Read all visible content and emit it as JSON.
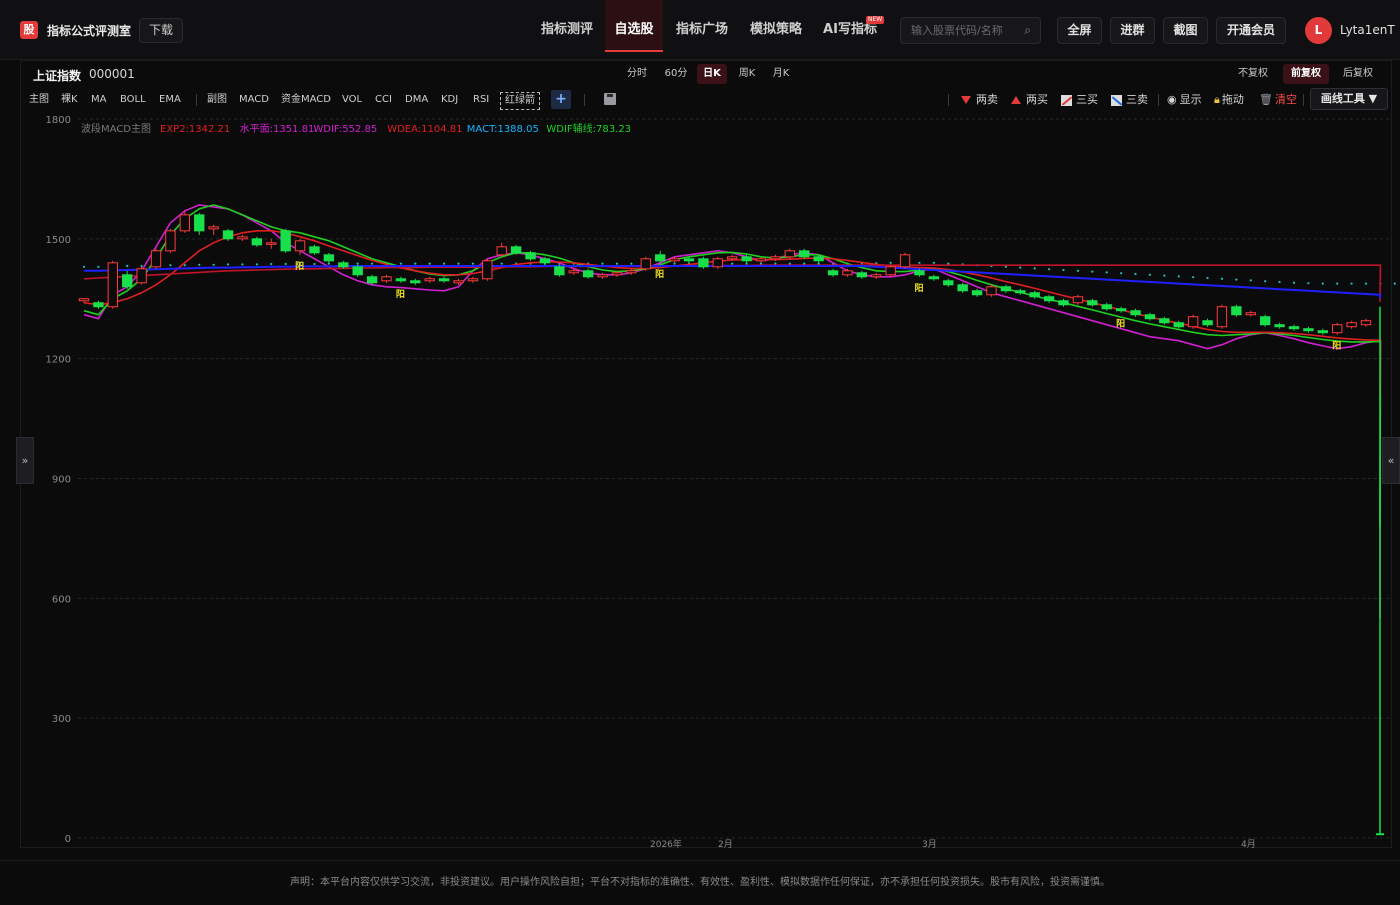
{
  "header": {
    "logo_char": "股",
    "brand": "指标公式评测室",
    "download": "下载",
    "nav": [
      "指标测评",
      "自选股",
      "指标广场",
      "模拟策略",
      "AI写指标"
    ],
    "nav_active": 1,
    "new_badge": "NEW",
    "search_placeholder": "输入股票代码/名称",
    "buttons": [
      "全屏",
      "进群",
      "截图",
      "开通会员"
    ],
    "avatar_letter": "L",
    "username": "Lyta1enT"
  },
  "stock": {
    "name": "上证指数",
    "code": "000001"
  },
  "periods": [
    "分时",
    "60分",
    "日K",
    "周K",
    "月K"
  ],
  "period_active": 2,
  "adjust": [
    "不复权",
    "前复权",
    "后复权"
  ],
  "adjust_active": 1,
  "indicators_main": [
    "主图",
    "裸K",
    "MA",
    "BOLL",
    "EMA"
  ],
  "indicators_sub": [
    "副图",
    "MACD",
    "资金MACD",
    "VOL",
    "CCI",
    "DMA",
    "KDJ",
    "RSI"
  ],
  "indicator_boxed": "红绿箭",
  "signals": {
    "sell2": "两卖",
    "buy2": "两买",
    "buy3": "三买",
    "sell3": "三卖",
    "show": "显示",
    "drag": "拖动",
    "clear": "清空",
    "draw_tools": "画线工具 ▼"
  },
  "legend": {
    "name": "波段MACD主图",
    "items": [
      {
        "label": "EXP2:1342.21",
        "color": "#e02020"
      },
      {
        "label": "水平面:1351.81",
        "color": "#d020d0"
      },
      {
        "label": "WDIF:552.85",
        "color": "#d020d0"
      },
      {
        "label": "WDEA:1104.81",
        "color": "#e02020"
      },
      {
        "label": "MACT:1388.05",
        "color": "#18b4ff"
      },
      {
        "label": "WDIF辅线:783.23",
        "color": "#20d020"
      }
    ]
  },
  "chart_data": {
    "type": "candlestick",
    "y_ticks": [
      1800,
      1500,
      1200,
      900,
      600,
      300,
      0
    ],
    "ylim": [
      0,
      1800
    ],
    "x_labels": [
      "2026年",
      "2月",
      "3月",
      "4月"
    ],
    "grid": true,
    "candles": [
      [
        1345,
        1350,
        1340,
        1352
      ],
      [
        1340,
        1330,
        1325,
        1345
      ],
      [
        1330,
        1440,
        1325,
        1445
      ],
      [
        1410,
        1380,
        1375,
        1420
      ],
      [
        1390,
        1425,
        1385,
        1430
      ],
      [
        1430,
        1470,
        1425,
        1475
      ],
      [
        1470,
        1520,
        1465,
        1525
      ],
      [
        1520,
        1560,
        1515,
        1570
      ],
      [
        1560,
        1520,
        1510,
        1565
      ],
      [
        1525,
        1530,
        1510,
        1535
      ],
      [
        1520,
        1500,
        1495,
        1525
      ],
      [
        1500,
        1505,
        1495,
        1510
      ],
      [
        1500,
        1485,
        1480,
        1505
      ],
      [
        1490,
        1490,
        1475,
        1500
      ],
      [
        1520,
        1470,
        1465,
        1525
      ],
      [
        1470,
        1495,
        1460,
        1500
      ],
      [
        1480,
        1465,
        1460,
        1485
      ],
      [
        1460,
        1445,
        1440,
        1465
      ],
      [
        1440,
        1430,
        1425,
        1445
      ],
      [
        1430,
        1410,
        1405,
        1435
      ],
      [
        1405,
        1390,
        1385,
        1410
      ],
      [
        1395,
        1405,
        1390,
        1410
      ],
      [
        1400,
        1395,
        1390,
        1405
      ],
      [
        1395,
        1390,
        1385,
        1400
      ],
      [
        1395,
        1400,
        1390,
        1405
      ],
      [
        1400,
        1395,
        1390,
        1405
      ],
      [
        1390,
        1395,
        1385,
        1400
      ],
      [
        1395,
        1400,
        1390,
        1405
      ],
      [
        1400,
        1445,
        1395,
        1450
      ],
      [
        1460,
        1480,
        1455,
        1490
      ],
      [
        1480,
        1465,
        1460,
        1485
      ],
      [
        1465,
        1450,
        1445,
        1470
      ],
      [
        1450,
        1440,
        1435,
        1455
      ],
      [
        1430,
        1410,
        1405,
        1435
      ],
      [
        1415,
        1420,
        1410,
        1425
      ],
      [
        1420,
        1405,
        1400,
        1425
      ],
      [
        1405,
        1410,
        1400,
        1415
      ],
      [
        1410,
        1415,
        1405,
        1420
      ],
      [
        1415,
        1420,
        1410,
        1425
      ],
      [
        1425,
        1450,
        1420,
        1455
      ],
      [
        1460,
        1445,
        1440,
        1470
      ],
      [
        1445,
        1450,
        1440,
        1455
      ],
      [
        1450,
        1445,
        1440,
        1455
      ],
      [
        1450,
        1430,
        1425,
        1455
      ],
      [
        1430,
        1450,
        1425,
        1455
      ],
      [
        1450,
        1455,
        1445,
        1460
      ],
      [
        1455,
        1445,
        1440,
        1460
      ],
      [
        1445,
        1450,
        1440,
        1455
      ],
      [
        1450,
        1455,
        1445,
        1460
      ],
      [
        1455,
        1470,
        1450,
        1475
      ],
      [
        1470,
        1455,
        1450,
        1475
      ],
      [
        1455,
        1445,
        1440,
        1460
      ],
      [
        1420,
        1410,
        1405,
        1425
      ],
      [
        1410,
        1420,
        1405,
        1425
      ],
      [
        1415,
        1405,
        1400,
        1420
      ],
      [
        1405,
        1410,
        1400,
        1415
      ],
      [
        1410,
        1430,
        1405,
        1435
      ],
      [
        1430,
        1460,
        1425,
        1465
      ],
      [
        1420,
        1410,
        1405,
        1425
      ],
      [
        1405,
        1400,
        1395,
        1410
      ],
      [
        1395,
        1385,
        1380,
        1400
      ],
      [
        1385,
        1370,
        1365,
        1390
      ],
      [
        1370,
        1360,
        1355,
        1375
      ],
      [
        1360,
        1380,
        1355,
        1385
      ],
      [
        1380,
        1370,
        1365,
        1385
      ],
      [
        1370,
        1365,
        1360,
        1375
      ],
      [
        1365,
        1355,
        1350,
        1370
      ],
      [
        1355,
        1345,
        1340,
        1360
      ],
      [
        1345,
        1335,
        1330,
        1350
      ],
      [
        1340,
        1355,
        1335,
        1360
      ],
      [
        1345,
        1335,
        1330,
        1350
      ],
      [
        1335,
        1325,
        1320,
        1340
      ],
      [
        1325,
        1320,
        1315,
        1330
      ],
      [
        1320,
        1310,
        1305,
        1325
      ],
      [
        1310,
        1300,
        1295,
        1315
      ],
      [
        1300,
        1290,
        1285,
        1305
      ],
      [
        1290,
        1280,
        1275,
        1295
      ],
      [
        1280,
        1305,
        1275,
        1310
      ],
      [
        1295,
        1285,
        1280,
        1300
      ],
      [
        1280,
        1330,
        1275,
        1335
      ],
      [
        1330,
        1310,
        1305,
        1335
      ],
      [
        1310,
        1315,
        1305,
        1320
      ],
      [
        1305,
        1285,
        1280,
        1310
      ],
      [
        1285,
        1280,
        1275,
        1290
      ],
      [
        1280,
        1275,
        1270,
        1285
      ],
      [
        1275,
        1270,
        1265,
        1280
      ],
      [
        1270,
        1265,
        1260,
        1275
      ],
      [
        1265,
        1285,
        1260,
        1290
      ],
      [
        1280,
        1290,
        1275,
        1295
      ],
      [
        1285,
        1295,
        1280,
        1300
      ]
    ],
    "yang_markers": [
      15,
      22,
      40,
      58,
      72,
      87
    ],
    "series": [
      {
        "name": "WDIF",
        "color": "#d020d0",
        "values": [
          1310,
          1300,
          1360,
          1380,
          1420,
          1480,
          1540,
          1570,
          1585,
          1580,
          1575,
          1560,
          1540,
          1520,
          1490,
          1470,
          1450,
          1430,
          1410,
          1395,
          1385,
          1380,
          1378,
          1375,
          1372,
          1370,
          1380,
          1420,
          1450,
          1460,
          1465,
          1460,
          1450,
          1440,
          1425,
          1415,
          1410,
          1410,
          1415,
          1425,
          1440,
          1455,
          1460,
          1465,
          1470,
          1465,
          1455,
          1445,
          1450,
          1460,
          1465,
          1460,
          1440,
          1420,
          1410,
          1405,
          1405,
          1410,
          1420,
          1425,
          1410,
          1395,
          1380,
          1365,
          1355,
          1345,
          1335,
          1325,
          1315,
          1305,
          1295,
          1285,
          1275,
          1265,
          1255,
          1250,
          1245,
          1235,
          1225,
          1235,
          1250,
          1260,
          1265,
          1258,
          1250,
          1240,
          1232,
          1225,
          1230,
          1240,
          1245,
          550
        ]
      },
      {
        "name": "WDIF辅线",
        "color": "#20d020",
        "values": [
          1320,
          1310,
          1350,
          1370,
          1400,
          1450,
          1510,
          1550,
          1575,
          1585,
          1575,
          1560,
          1545,
          1530,
          1520,
          1515,
          1505,
          1495,
          1480,
          1465,
          1450,
          1440,
          1430,
          1420,
          1412,
          1408,
          1410,
          1420,
          1440,
          1455,
          1465,
          1465,
          1460,
          1452,
          1440,
          1430,
          1422,
          1418,
          1420,
          1425,
          1435,
          1448,
          1455,
          1460,
          1465,
          1466,
          1462,
          1455,
          1452,
          1455,
          1460,
          1460,
          1450,
          1438,
          1428,
          1420,
          1418,
          1418,
          1422,
          1425,
          1418,
          1408,
          1396,
          1385,
          1375,
          1366,
          1357,
          1348,
          1340,
          1331,
          1322,
          1313,
          1304,
          1295,
          1287,
          1280,
          1273,
          1266,
          1260,
          1258,
          1260,
          1262,
          1265,
          1262,
          1258,
          1253,
          1248,
          1244,
          1242,
          1242,
          1243,
          780
        ]
      },
      {
        "name": "WDEA",
        "color": "#e02020",
        "values": [
          1340,
          1335,
          1340,
          1350,
          1365,
          1385,
          1410,
          1440,
          1470,
          1490,
          1505,
          1515,
          1520,
          1520,
          1515,
          1505,
          1495,
          1482,
          1470,
          1458,
          1446,
          1436,
          1427,
          1420,
          1414,
          1410,
          1410,
          1413,
          1420,
          1428,
          1436,
          1440,
          1442,
          1442,
          1440,
          1436,
          1432,
          1428,
          1426,
          1426,
          1428,
          1432,
          1436,
          1440,
          1444,
          1447,
          1448,
          1448,
          1448,
          1449,
          1451,
          1452,
          1450,
          1446,
          1441,
          1436,
          1432,
          1429,
          1428,
          1427,
          1423,
          1417,
          1410,
          1402,
          1393,
          1385,
          1376,
          1367,
          1358,
          1349,
          1340,
          1331,
          1322,
          1313,
          1304,
          1296,
          1289,
          1281,
          1273,
          1268,
          1266,
          1266,
          1266,
          1265,
          1263,
          1260,
          1256,
          1252,
          1249,
          1247,
          1246,
          1105
        ]
      },
      {
        "name": "EXP2",
        "color": "#c0142a",
        "values": [
          1400,
          1402,
          1404,
          1406,
          1408,
          1410,
          1412,
          1414,
          1416,
          1418,
          1420,
          1421,
          1422,
          1423,
          1424,
          1425,
          1425,
          1426,
          1426,
          1427,
          1427,
          1428,
          1428,
          1428,
          1429,
          1429,
          1429,
          1429,
          1430,
          1430,
          1430,
          1430,
          1431,
          1431,
          1431,
          1431,
          1431,
          1432,
          1432,
          1432,
          1432,
          1432,
          1433,
          1433,
          1433,
          1433,
          1433,
          1434,
          1434,
          1434,
          1434,
          1434,
          1434,
          1434,
          1434,
          1434,
          1434,
          1434,
          1434,
          1434,
          1434,
          1434,
          1434,
          1434,
          1434,
          1434,
          1434,
          1434,
          1434,
          1434,
          1434,
          1434,
          1434,
          1434,
          1434,
          1434,
          1434,
          1434,
          1434,
          1434,
          1434,
          1434,
          1434,
          1434,
          1434,
          1434,
          1434,
          1434,
          1434,
          1434,
          1434,
          1342
        ]
      },
      {
        "name": "水平面",
        "color": "#2020ff",
        "values": [
          1420,
          1420,
          1421,
          1422,
          1423,
          1424,
          1425,
          1426,
          1427,
          1428,
          1428,
          1429,
          1429,
          1430,
          1430,
          1431,
          1431,
          1431,
          1432,
          1432,
          1432,
          1432,
          1432,
          1432,
          1432,
          1432,
          1432,
          1432,
          1432,
          1432,
          1432,
          1432,
          1432,
          1432,
          1432,
          1432,
          1432,
          1432,
          1432,
          1432,
          1432,
          1432,
          1432,
          1432,
          1432,
          1432,
          1432,
          1432,
          1432,
          1432,
          1432,
          1432,
          1432,
          1432,
          1432,
          1430,
          1428,
          1426,
          1424,
          1422,
          1420,
          1418,
          1416,
          1414,
          1412,
          1410,
          1408,
          1406,
          1404,
          1402,
          1400,
          1398,
          1396,
          1394,
          1392,
          1390,
          1388,
          1386,
          1384,
          1382,
          1380,
          1378,
          1376,
          1374,
          1372,
          1370,
          1368,
          1366,
          1364,
          1362,
          1360,
          1351
        ]
      },
      {
        "name": "MACT",
        "color": "#20a0ff",
        "values": [
          1430,
          1430,
          1431,
          1432,
          1432,
          1433,
          1434,
          1434,
          1435,
          1435,
          1436,
          1436,
          1436,
          1437,
          1437,
          1437,
          1437,
          1438,
          1438,
          1438,
          1438,
          1438,
          1438,
          1438,
          1438,
          1438,
          1438,
          1438,
          1438,
          1438,
          1438,
          1438,
          1438,
          1438,
          1438,
          1438,
          1438,
          1438,
          1438,
          1438,
          1438,
          1438,
          1438,
          1438,
          1438,
          1438,
          1438,
          1438,
          1438,
          1438,
          1438,
          1438,
          1438,
          1438,
          1439,
          1439,
          1440,
          1440,
          1440,
          1440,
          1438,
          1436,
          1434,
          1432,
          1430,
          1428,
          1426,
          1424,
          1422,
          1420,
          1418,
          1416,
          1414,
          1412,
          1410,
          1408,
          1406,
          1404,
          1402,
          1400,
          1398,
          1396,
          1394,
          1392,
          1390,
          1389,
          1388,
          1388,
          1388,
          1388,
          1388,
          1388
        ]
      }
    ]
  },
  "footer": "声明：本平台内容仅供学习交流，非投资建议。用户操作风险自担；平台不对指标的准确性、有效性、盈利性、模拟数据作任何保证，亦不承担任何投资损失。股市有风险，投资需谨慎。"
}
